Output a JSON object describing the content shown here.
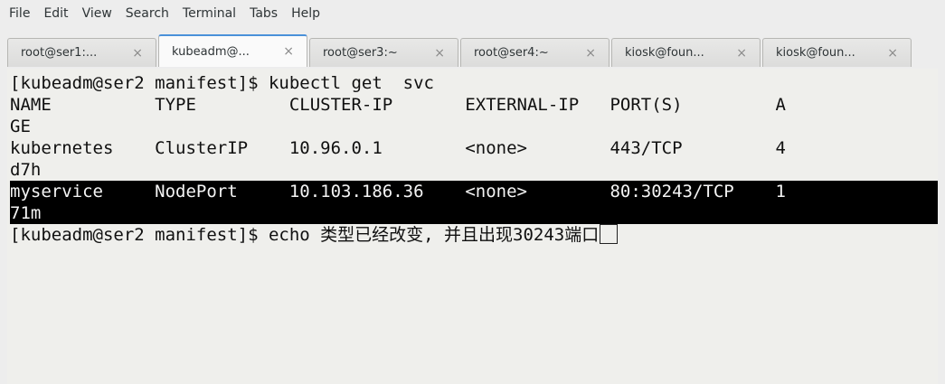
{
  "menu": [
    "File",
    "Edit",
    "View",
    "Search",
    "Terminal",
    "Tabs",
    "Help"
  ],
  "tabs": [
    {
      "label": "root@ser1:..."
    },
    {
      "label": "kubeadm@..."
    },
    {
      "label": "root@ser3:~"
    },
    {
      "label": "root@ser4:~"
    },
    {
      "label": "kiosk@foun..."
    },
    {
      "label": "kiosk@foun..."
    }
  ],
  "close_glyph": "×",
  "terminal": {
    "lines": [
      "[kubeadm@ser2 manifest]$ kubectl get  svc",
      "NAME          TYPE         CLUSTER-IP       EXTERNAL-IP   PORT(S)         A",
      "GE",
      "kubernetes    ClusterIP    10.96.0.1        <none>        443/TCP         4",
      "d7h",
      "myservice     NodePort     10.103.186.36    <none>        80:30243/TCP    1",
      "71m",
      "[kubeadm@ser2 manifest]$ echo 类型已经改变, 并且出现30243端口"
    ]
  }
}
